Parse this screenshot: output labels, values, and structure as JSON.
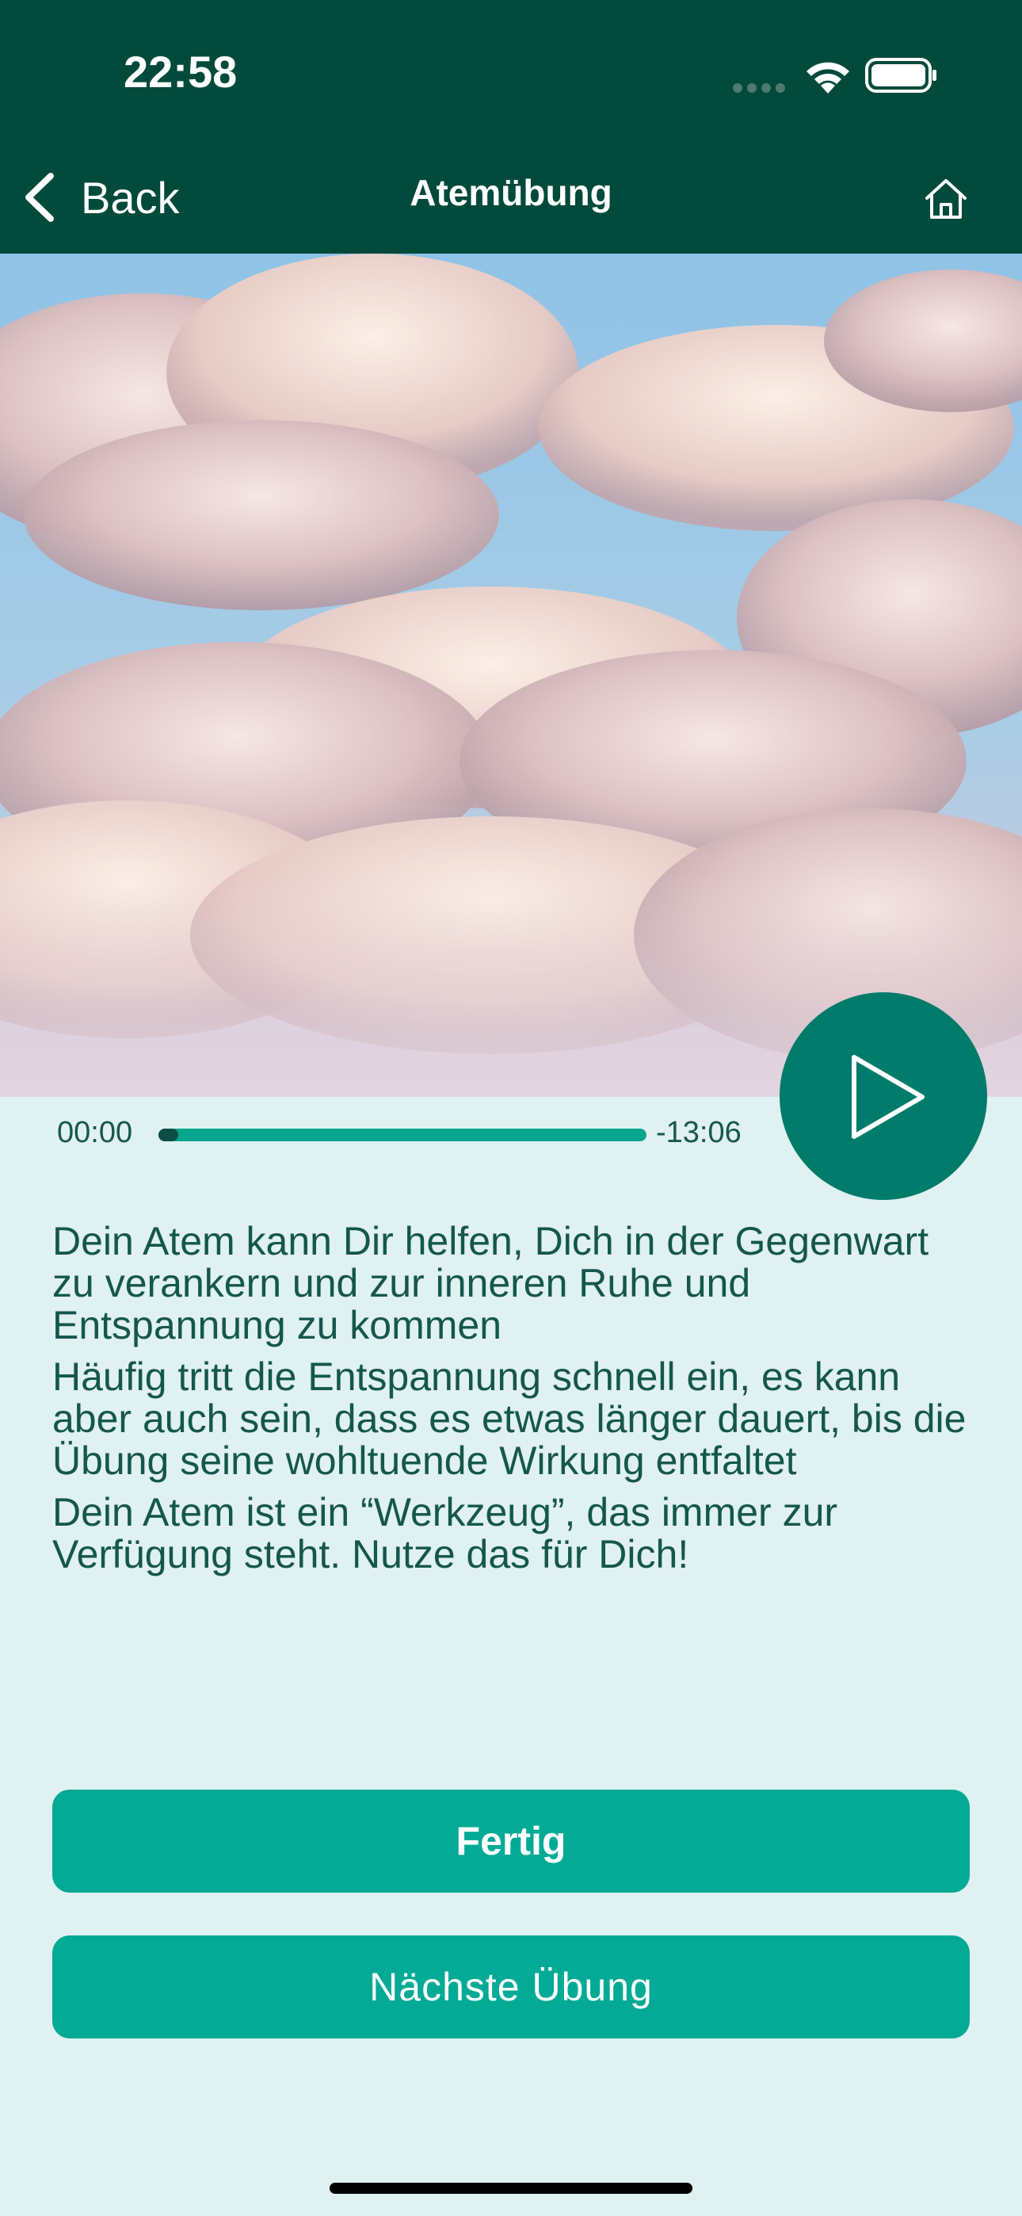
{
  "status_bar": {
    "time": "22:58"
  },
  "nav": {
    "back_label": "Back",
    "title": "Atemübung"
  },
  "player": {
    "elapsed": "00:00",
    "remaining": "-13:06",
    "progress_fraction": 0.04
  },
  "description": {
    "paragraphs": [
      "Dein Atem kann Dir helfen, Dich in der Gegenwart zu verankern und zur inneren Ruhe und Entspannung zu kommen",
      "Häufig tritt die Entspannung schnell ein, es kann aber auch sein, dass es etwas länger dauert, bis die Übung seine wohltuende Wirkung entfaltet",
      "Dein Atem ist ein “Werkzeug”, das immer zur Verfügung steht. Nutze das für Dich!"
    ]
  },
  "actions": {
    "done_label": "Fertig",
    "next_label": "Nächste Übung"
  },
  "colors": {
    "header": "#014a3c",
    "background": "#e0f1f1",
    "accent": "#03aa95",
    "play_button": "#017b6b",
    "text": "#14574c"
  },
  "icons": {
    "back": "chevron-left-icon",
    "home": "home-icon",
    "play": "play-icon",
    "wifi": "wifi-icon",
    "battery": "battery-icon"
  }
}
